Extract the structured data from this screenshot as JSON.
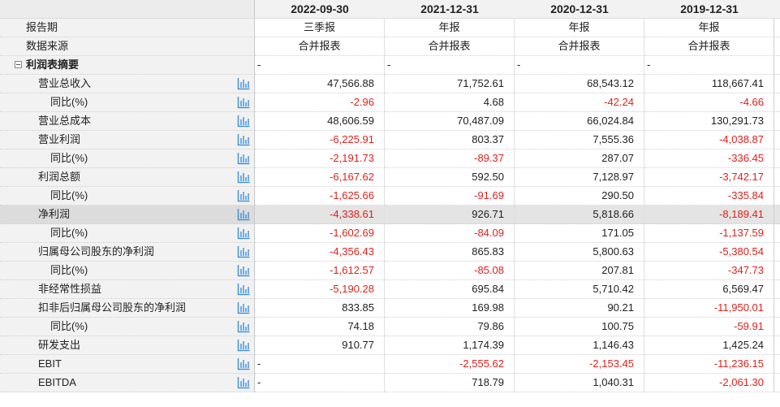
{
  "columns": [
    {
      "date": "2022-09-30",
      "report_type": "三季报",
      "source": "合并报表"
    },
    {
      "date": "2021-12-31",
      "report_type": "年报",
      "source": "合并报表"
    },
    {
      "date": "2020-12-31",
      "report_type": "年报",
      "source": "合并报表"
    },
    {
      "date": "2019-12-31",
      "report_type": "年报",
      "source": "合并报表"
    }
  ],
  "header_labels": {
    "report_period": "报告期",
    "data_source": "数据来源"
  },
  "section": {
    "label": "利润表摘要",
    "toggle": "minus-square-icon",
    "values": [
      "-",
      "-",
      "-",
      "-"
    ]
  },
  "rows": [
    {
      "label": "营业总收入",
      "level": 1,
      "values": [
        "47,566.88",
        "71,752.61",
        "68,543.12",
        "118,667.41"
      ]
    },
    {
      "label": "同比(%)",
      "level": 2,
      "values": [
        "-2.96",
        "4.68",
        "-42.24",
        "-4.66"
      ]
    },
    {
      "label": "营业总成本",
      "level": 1,
      "values": [
        "48,606.59",
        "70,487.09",
        "66,024.84",
        "130,291.73"
      ]
    },
    {
      "label": "营业利润",
      "level": 1,
      "values": [
        "-6,225.91",
        "803.37",
        "7,555.36",
        "-4,038.87"
      ]
    },
    {
      "label": "同比(%)",
      "level": 2,
      "values": [
        "-2,191.73",
        "-89.37",
        "287.07",
        "-336.45"
      ]
    },
    {
      "label": "利润总额",
      "level": 1,
      "values": [
        "-6,167.62",
        "592.50",
        "7,128.97",
        "-3,742.17"
      ]
    },
    {
      "label": "同比(%)",
      "level": 2,
      "values": [
        "-1,625.66",
        "-91.69",
        "290.50",
        "-335.84"
      ]
    },
    {
      "label": "净利润",
      "level": 1,
      "highlight": true,
      "values": [
        "-4,338.61",
        "926.71",
        "5,818.66",
        "-8,189.41"
      ]
    },
    {
      "label": "同比(%)",
      "level": 2,
      "values": [
        "-1,602.69",
        "-84.09",
        "171.05",
        "-1,137.59"
      ]
    },
    {
      "label": "归属母公司股东的净利润",
      "level": 1,
      "values": [
        "-4,356.43",
        "865.83",
        "5,800.63",
        "-5,380.54"
      ]
    },
    {
      "label": "同比(%)",
      "level": 2,
      "values": [
        "-1,612.57",
        "-85.08",
        "207.81",
        "-347.73"
      ]
    },
    {
      "label": "非经常性损益",
      "level": 1,
      "values": [
        "-5,190.28",
        "695.84",
        "5,710.42",
        "6,569.47"
      ]
    },
    {
      "label": "扣非后归属母公司股东的净利润",
      "level": 1,
      "values": [
        "833.85",
        "169.98",
        "90.21",
        "-11,950.01"
      ]
    },
    {
      "label": "同比(%)",
      "level": 2,
      "values": [
        "74.18",
        "79.86",
        "100.75",
        "-59.91"
      ]
    },
    {
      "label": "研发支出",
      "level": 1,
      "values": [
        "910.77",
        "1,174.39",
        "1,146.43",
        "1,425.24"
      ]
    },
    {
      "label": "EBIT",
      "level": 1,
      "values": [
        "-",
        "-2,555.62",
        "-2,153.45",
        "-11,236.15"
      ]
    },
    {
      "label": "EBITDA",
      "level": 1,
      "values": [
        "-",
        "718.79",
        "1,040.31",
        "-2,061.30"
      ]
    }
  ],
  "row_icon": "bar-chart-icon",
  "colors": {
    "negative": "#e0211b",
    "icon": "#3a8fd9",
    "header_bg": "#f2f2f2"
  }
}
